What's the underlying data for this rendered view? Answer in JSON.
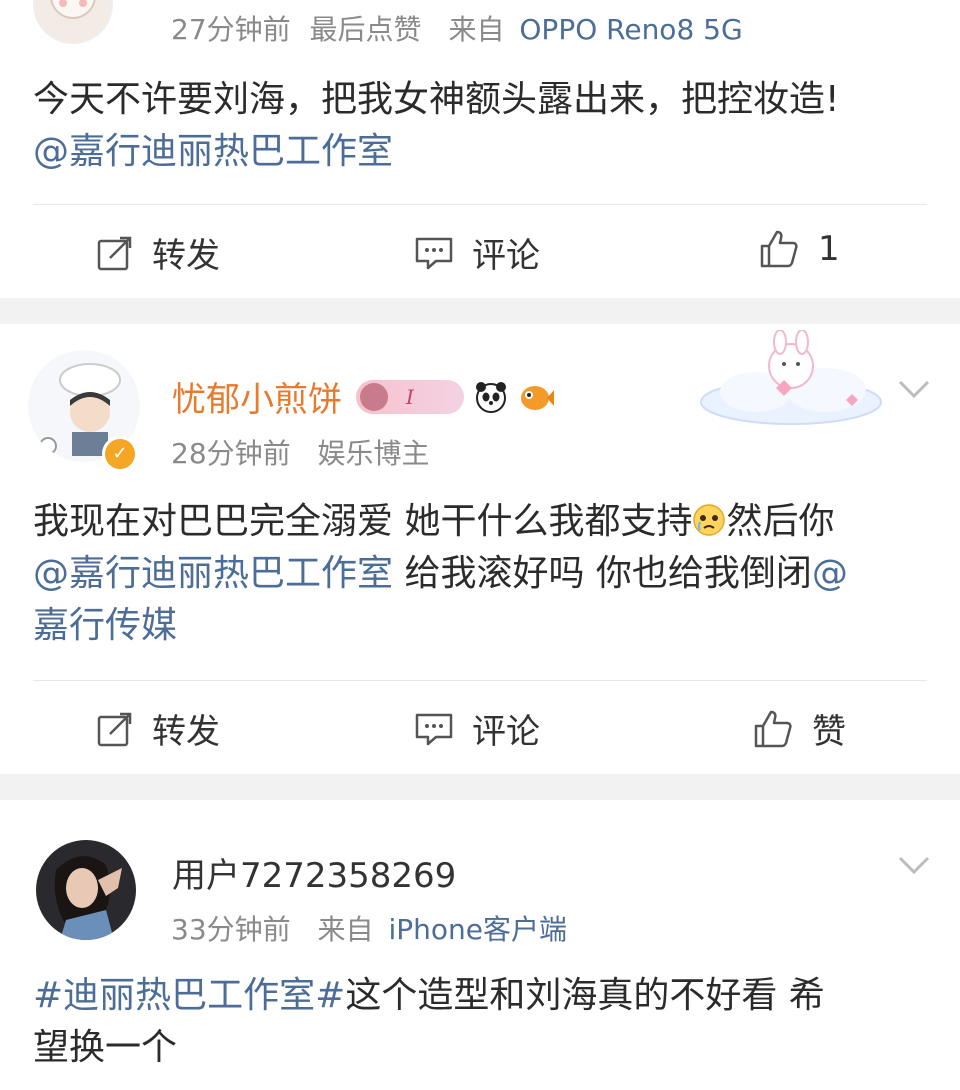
{
  "post1": {
    "meta_time": "27分钟前",
    "meta_extra": "最后点赞",
    "meta_from": "来自",
    "meta_device": "OPPO Reno8 5G",
    "text_plain": "今天不许要刘海，把我女神额头露出来，把控妆造!",
    "mention": "@嘉行迪丽热巴工作室",
    "actions": {
      "repost": "转发",
      "comment": "评论",
      "like": "1"
    }
  },
  "post2": {
    "username": "忧郁小煎饼",
    "badge": "I",
    "meta_time": "28分钟前",
    "meta_role": "娱乐博主",
    "text_line1": "我现在对巴巴完全溺爱 她干什么我都支持",
    "text_line1b": "然后你",
    "mention1": "@嘉行迪丽热巴工作室",
    "text_line2": " 给我滚好吗 你也给我倒闭",
    "mention2_start": "@",
    "mention2_end": "嘉行传媒",
    "actions": {
      "repost": "转发",
      "comment": "评论",
      "like": "赞"
    }
  },
  "post3": {
    "username": "用户7272358269",
    "meta_time": "33分钟前",
    "meta_from": "来自",
    "meta_device": "iPhone客户端",
    "hashtag": "#迪丽热巴工作室#",
    "text_after_hashtag": "这个造型和刘海真的不好看 希",
    "text_line2": "望换一个"
  },
  "colors": {
    "link": "#4d6d99",
    "orange_name": "#e87a2c",
    "gap": "#f2f2f2"
  },
  "icons": [
    "repost-icon",
    "comment-icon",
    "like-icon",
    "chevron-down-icon",
    "verified-badge-icon",
    "panda-icon",
    "fish-icon",
    "cloud-bunny-decoration"
  ]
}
